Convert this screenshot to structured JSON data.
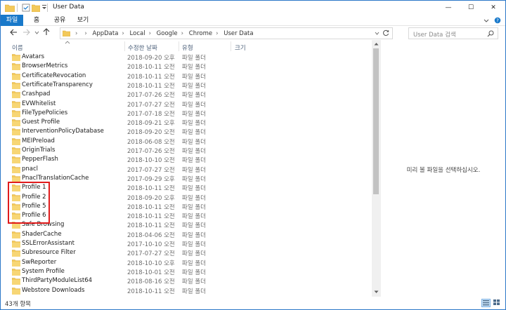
{
  "window": {
    "title": "User Data",
    "minimize_glyph": "—",
    "maximize_glyph": "☐",
    "close_glyph": "✕"
  },
  "ribbon": {
    "tabs": [
      "파일",
      "홈",
      "공유",
      "보기"
    ]
  },
  "address": {
    "crumbs": [
      "AppData",
      "Local",
      "Google",
      "Chrome",
      "User Data"
    ],
    "search_placeholder": "User Data 검색"
  },
  "columns": {
    "name": "이름",
    "date": "수정한 날짜",
    "type": "유형",
    "size": "크기"
  },
  "files": [
    {
      "name": "Avatars",
      "date": "2018-09-20 오후...",
      "type": "파일 폴더"
    },
    {
      "name": "BrowserMetrics",
      "date": "2018-10-11 오전...",
      "type": "파일 폴더"
    },
    {
      "name": "CertificateRevocation",
      "date": "2018-10-11 오전...",
      "type": "파일 폴더"
    },
    {
      "name": "CertificateTransparency",
      "date": "2018-10-11 오전...",
      "type": "파일 폴더"
    },
    {
      "name": "Crashpad",
      "date": "2017-07-26 오전...",
      "type": "파일 폴더"
    },
    {
      "name": "EVWhitelist",
      "date": "2017-07-27 오전...",
      "type": "파일 폴더"
    },
    {
      "name": "FileTypePolicies",
      "date": "2017-07-18 오전...",
      "type": "파일 폴더"
    },
    {
      "name": "Guest Profile",
      "date": "2018-09-21 오후...",
      "type": "파일 폴더"
    },
    {
      "name": "InterventionPolicyDatabase",
      "date": "2018-09-20 오전...",
      "type": "파일 폴더"
    },
    {
      "name": "MEIPreload",
      "date": "2018-06-08 오전...",
      "type": "파일 폴더"
    },
    {
      "name": "OriginTrials",
      "date": "2017-07-26 오전...",
      "type": "파일 폴더"
    },
    {
      "name": "PepperFlash",
      "date": "2018-10-10 오전...",
      "type": "파일 폴더"
    },
    {
      "name": "pnacl",
      "date": "2017-07-27 오전...",
      "type": "파일 폴더"
    },
    {
      "name": "PnaclTranslationCache",
      "date": "2017-09-29 오후...",
      "type": "파일 폴더"
    },
    {
      "name": "Profile 1",
      "date": "2018-10-11 오전...",
      "type": "파일 폴더"
    },
    {
      "name": "Profile 2",
      "date": "2018-09-20 오후...",
      "type": "파일 폴더"
    },
    {
      "name": "Profile 5",
      "date": "2018-10-11 오전...",
      "type": "파일 폴더"
    },
    {
      "name": "Profile 6",
      "date": "2018-10-11 오전...",
      "type": "파일 폴더"
    },
    {
      "name": "Safe Browsing",
      "date": "2018-10-11 오전...",
      "type": "파일 폴더"
    },
    {
      "name": "ShaderCache",
      "date": "2018-04-06 오전...",
      "type": "파일 폴더"
    },
    {
      "name": "SSLErrorAssistant",
      "date": "2017-10-10 오전...",
      "type": "파일 폴더"
    },
    {
      "name": "Subresource Filter",
      "date": "2017-07-27 오전...",
      "type": "파일 폴더"
    },
    {
      "name": "SwReporter",
      "date": "2018-10-10 오후...",
      "type": "파일 폴더"
    },
    {
      "name": "System Profile",
      "date": "2018-10-01 오전...",
      "type": "파일 폴더"
    },
    {
      "name": "ThirdPartyModuleList64",
      "date": "2018-08-16 오전...",
      "type": "파일 폴더"
    },
    {
      "name": "Webstore Downloads",
      "date": "2018-10-11 오전...",
      "type": "파일 폴더"
    }
  ],
  "preview": {
    "message": "미리 볼 파일을 선택하십시오."
  },
  "status": {
    "item_count": "43개 항목"
  },
  "colors": {
    "accent": "#1979ca",
    "folder": "#f3c95a",
    "highlight": "#e01b1b"
  }
}
